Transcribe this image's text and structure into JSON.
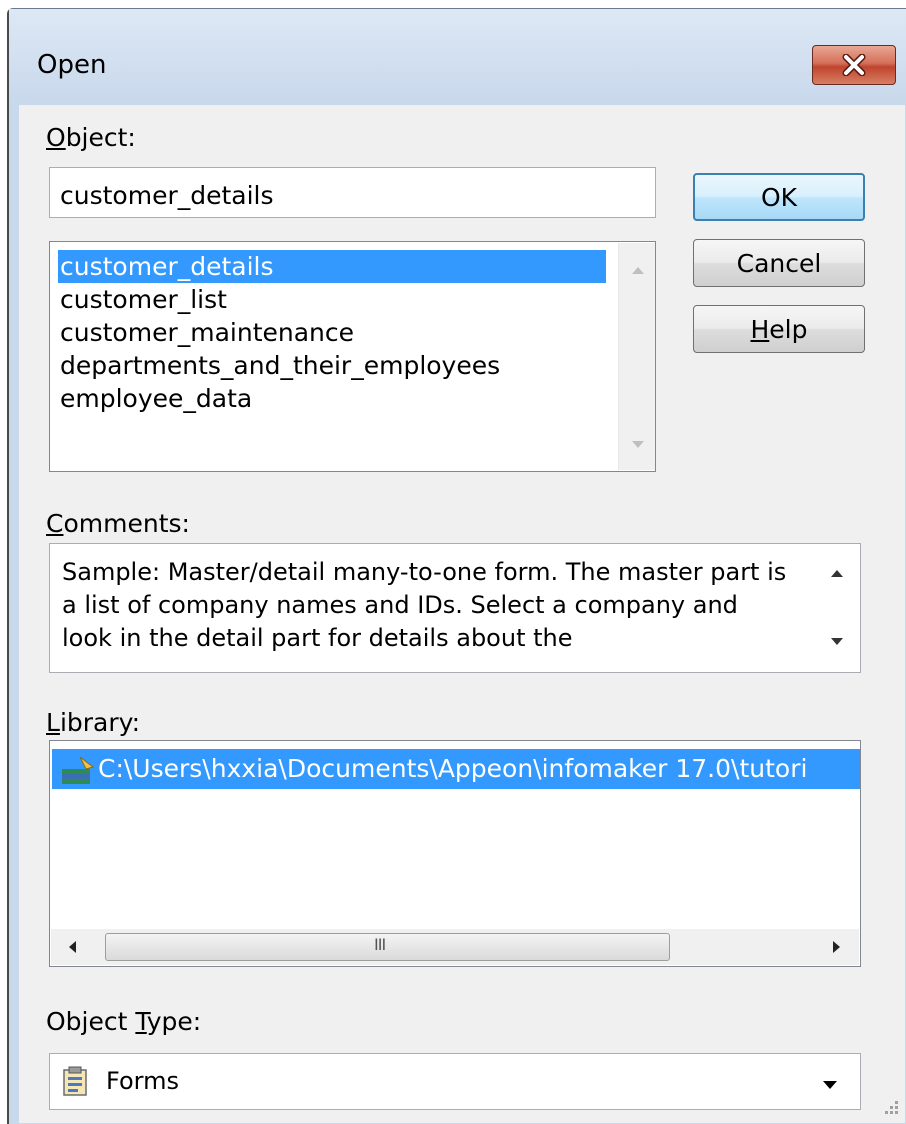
{
  "window": {
    "title": "Open",
    "close_icon": "close-icon"
  },
  "object": {
    "label_accel": "O",
    "label_rest": "bject:",
    "value": "customer_details"
  },
  "object_list": {
    "items": [
      "customer_details",
      "customer_list",
      "customer_maintenance",
      "departments_and_their_employees",
      "employee_data"
    ],
    "selected_index": 0
  },
  "buttons": {
    "ok": "OK",
    "cancel": "Cancel",
    "help_accel": "H",
    "help_rest": "elp"
  },
  "comments": {
    "label_accel": "C",
    "label_rest": "omments:",
    "text": "Sample: Master/detail many-to-one form. The master part is a list of company names and IDs. Select a company and look in the detail part for details about the"
  },
  "library": {
    "label_accel": "L",
    "label_rest": "ibrary:",
    "items": [
      {
        "path": "C:\\Users\\hxxia\\Documents\\Appeon\\infomaker 17.0\\tutori",
        "icon": "library-icon"
      }
    ],
    "scroll_grip": "III"
  },
  "object_type": {
    "label_prefix": "Object ",
    "label_accel": "T",
    "label_rest": "ype:",
    "value": "Forms",
    "icon": "forms-icon"
  },
  "colors": {
    "selection": "#3399ff",
    "client_bg": "#f0f0f0",
    "frame_bg": "#c9d9ec"
  }
}
